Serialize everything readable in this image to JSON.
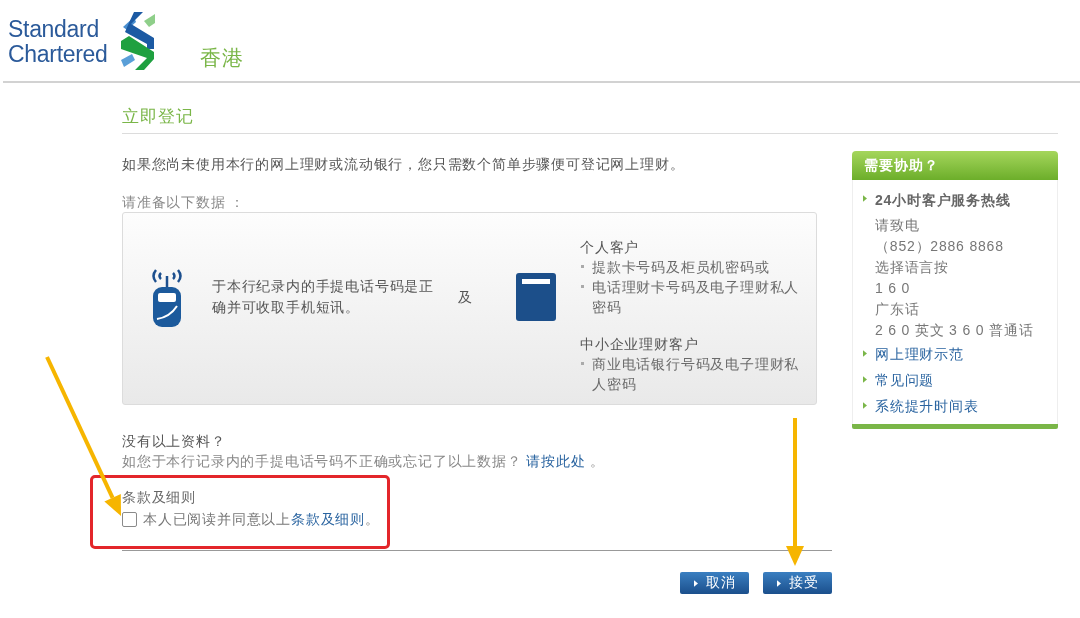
{
  "header": {
    "brand_line_1": "Standard",
    "brand_line_2": "Chartered",
    "region": "香港"
  },
  "page_title": "立即登记",
  "intro": "如果您尚未使用本行的网上理财或流动银行，您只需数个简单步骤便可登记网上理财。",
  "prepare_label": "请准备以下数据 ：",
  "requirements": {
    "phone_text": "于本行纪录内的手提电话号码是正确并可收取手机短讯。",
    "conjunction": "及",
    "groups": [
      {
        "title": "个人客户",
        "bullets": [
          "提款卡号码及柜员机密码或",
          "电话理财卡号码及电子理财私人密码"
        ]
      },
      {
        "title": "中小企业理财客户",
        "bullets": [
          "商业电话银行号码及电子理财私人密码"
        ]
      }
    ]
  },
  "missing_info": {
    "title": "没有以上资料？",
    "text": "如您于本行记录内的手提电话号码不正确或忘记了以上数据？",
    "link": "请按此处",
    "after": "。"
  },
  "terms": {
    "title": "条款及细则",
    "checked": false,
    "text": "本人已阅读并同意以上",
    "link": "条款及细则",
    "after": "。"
  },
  "buttons": [
    {
      "label": "取消"
    },
    {
      "label": "接受"
    }
  ],
  "help_panel": {
    "title": "需要协助？",
    "items": [
      {
        "kind": "info",
        "title": "24小时客户服务热线",
        "lines": [
          "请致电",
          "（852）2886 8868",
          "选择语言按",
          "1 6 0",
          "广东话",
          "2 6 0 英文 3 6 0 普通话"
        ]
      },
      {
        "kind": "link",
        "label": "网上理财示范"
      },
      {
        "kind": "link",
        "label": "常见问题"
      },
      {
        "kind": "link",
        "label": "系统提升时间表"
      }
    ]
  }
}
